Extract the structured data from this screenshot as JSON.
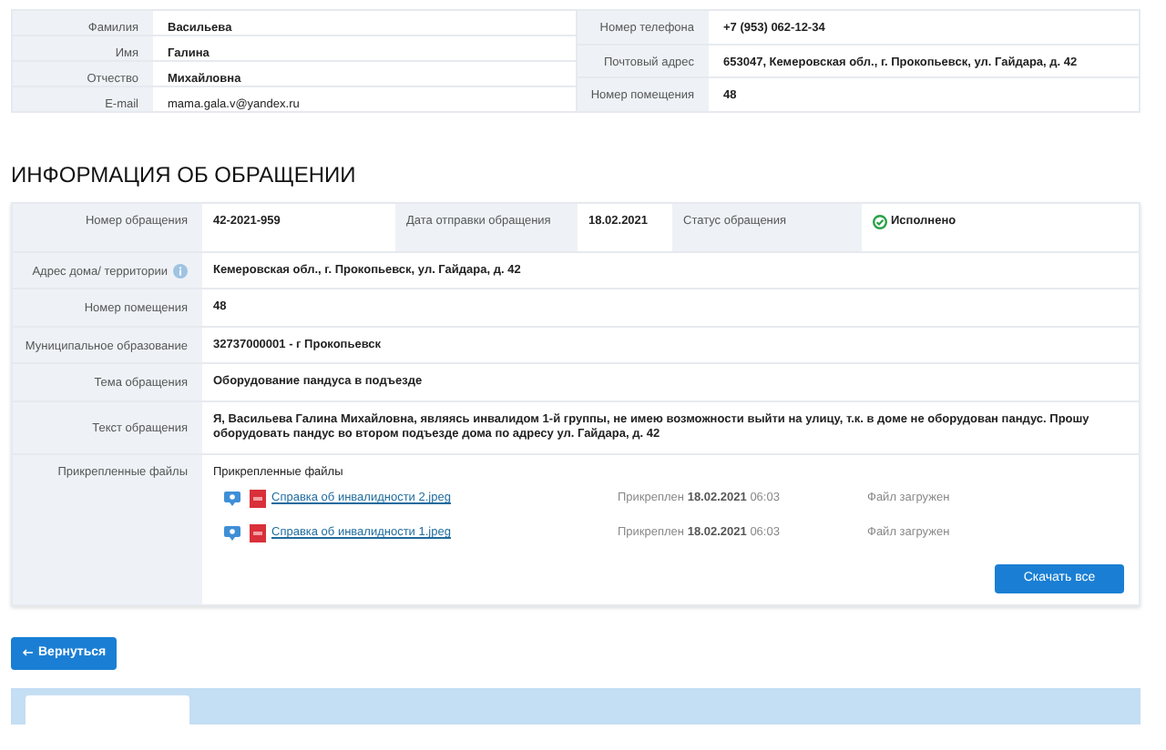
{
  "applicant": {
    "left": [
      {
        "label": "Фамилия",
        "value": "Васильева",
        "kind": "strong"
      },
      {
        "label": "Имя",
        "value": "Галина",
        "kind": "strong"
      },
      {
        "label": "Отчество",
        "value": "Михайловна",
        "kind": "strong"
      },
      {
        "label": "E-mail",
        "value": "mama.gala.v@yandex.ru",
        "kind": "plain"
      }
    ],
    "right": [
      {
        "label": "Номер телефона",
        "value": "+7 (953) 062-12-34",
        "kind": "strong"
      },
      {
        "label": "Почтовый адрес",
        "value": "653047, Кемеровская обл., г. Прокопьевск, ул. Гайдара, д. 42",
        "kind": "strong"
      },
      {
        "label": "Номер помещения",
        "value": "48",
        "kind": "strong"
      }
    ]
  },
  "request": {
    "heading": "ИНФОРМАЦИЯ ОБ ОБРАЩЕНИИ",
    "summary": [
      {
        "label": "Номер обращения",
        "value": "42-2021-959",
        "kind": "text"
      },
      {
        "label": "Дата отправки обращения",
        "value": "18.02.2021",
        "kind": "text"
      },
      {
        "label": "Статус обращения",
        "value": "Исполнено",
        "kind": "status-done"
      }
    ],
    "rows": [
      {
        "label": "Адрес дома/ территории",
        "value": "Кемеровская обл., г. Прокопьевск, ул. Гайдара, д. 42",
        "info": true
      },
      {
        "label": "Номер помещения",
        "value": "48",
        "info": false
      },
      {
        "label": "Муниципальное образование",
        "value": "32737000001 - г Прокопьевск",
        "info": false
      },
      {
        "label": "Тема обращения",
        "value": "Оборудование пандуса в подъезде",
        "info": false
      },
      {
        "label": "Текст обращения",
        "value": "Я, Васильева Галина Михайловна, являясь инвалидом 1-й группы, не имею возможности выйти на улицу, т.к. в доме не оборудован пандус. Прошу оборудовать пандус во втором подъезде дома по адресу ул. Гайдара, д. 42",
        "info": false
      }
    ],
    "attachments": {
      "label": "Прикрепленные файлы",
      "title": "Прикрепленные файлы",
      "files": [
        {
          "name": "Справка об инвалидности 2.jpeg",
          "attached": "Прикреплен **18.02.2021**",
          "time": "06:03",
          "status": "Файл загружен"
        },
        {
          "name": "Справка об инвалидности 1.jpeg",
          "attached": "Прикреплен **18.02.2021**",
          "time": "06:03",
          "status": "Файл загружен"
        }
      ],
      "download_button": "Скачать все"
    }
  },
  "back_button": "Вернуться"
}
